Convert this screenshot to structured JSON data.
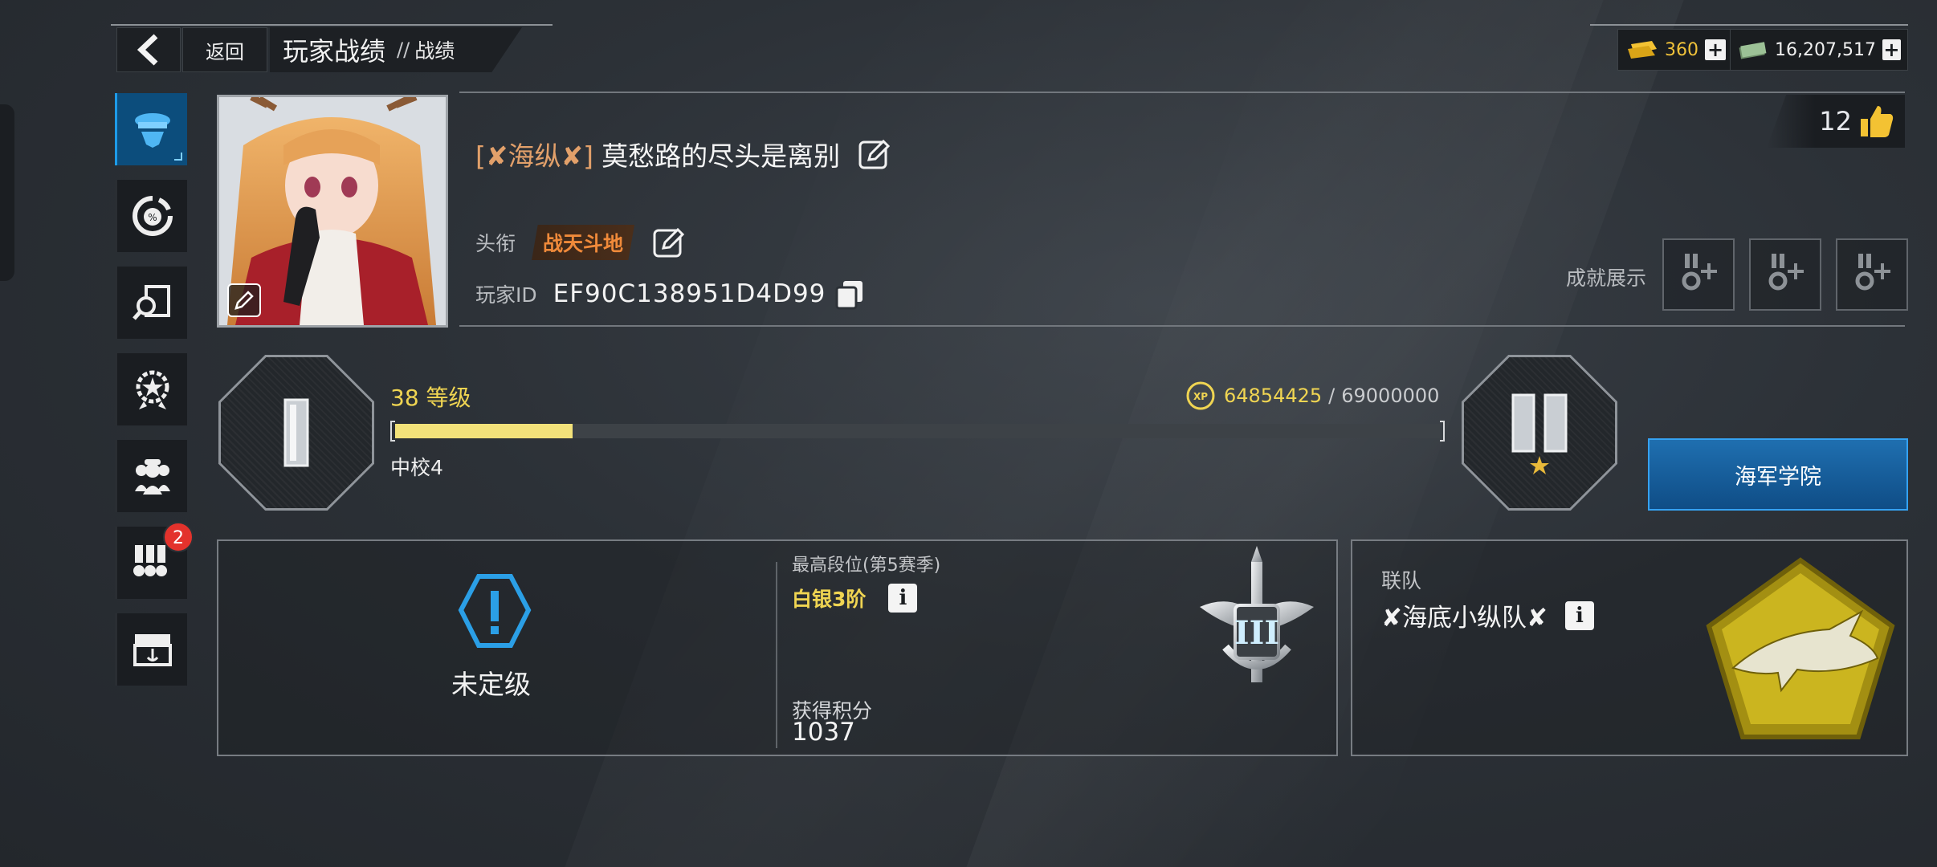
{
  "header": {
    "back_label": "返回",
    "title": "玩家战绩",
    "separator": "//",
    "subtitle": "战绩"
  },
  "currency": {
    "gold": "360",
    "cash": "16,207,517",
    "gold_icon": "gold-bar-icon",
    "cash_icon": "banknote-icon"
  },
  "sidebar": {
    "items": [
      {
        "icon": "officer-cap-icon",
        "active": true
      },
      {
        "icon": "percent-gauge-icon",
        "active": false
      },
      {
        "icon": "magnifier-search-icon",
        "active": false
      },
      {
        "icon": "star-wheel-emblem-icon",
        "active": false
      },
      {
        "icon": "crew-members-icon",
        "active": false
      },
      {
        "icon": "medals-icon",
        "badge": "2",
        "active": false
      },
      {
        "icon": "anchor-chest-icon",
        "active": false
      }
    ]
  },
  "profile": {
    "clan_tag": "[✘海纵✘]",
    "name": "莫愁路的尽头是离别",
    "title_label": "头衔",
    "title_value": "战天斗地",
    "id_label": "玩家ID",
    "player_id": "EF90C138951D4D99",
    "likes": "12",
    "achievements_label": "成就展示"
  },
  "level": {
    "level_number": "38",
    "level_label": "等级",
    "rank": "中校4",
    "xp_current": "64854425",
    "xp_separator": "/",
    "xp_max": "69000000",
    "progress": 0.17,
    "academy_button": "海军学院"
  },
  "ranking": {
    "unranked": "未定级",
    "best_label": "最高段位(第5赛季)",
    "best_value": "白银3阶",
    "score_label": "获得积分",
    "score_value": "1037",
    "emblem_numeral": "III"
  },
  "fleet": {
    "label": "联队",
    "name": "✘海底小纵队✘"
  },
  "colors": {
    "accent_blue": "#1e9be8",
    "gold_text": "#f0d552",
    "title_orange": "#f08a3a",
    "clan_tag": "#e2a06a",
    "badge_red": "#e3322c"
  }
}
